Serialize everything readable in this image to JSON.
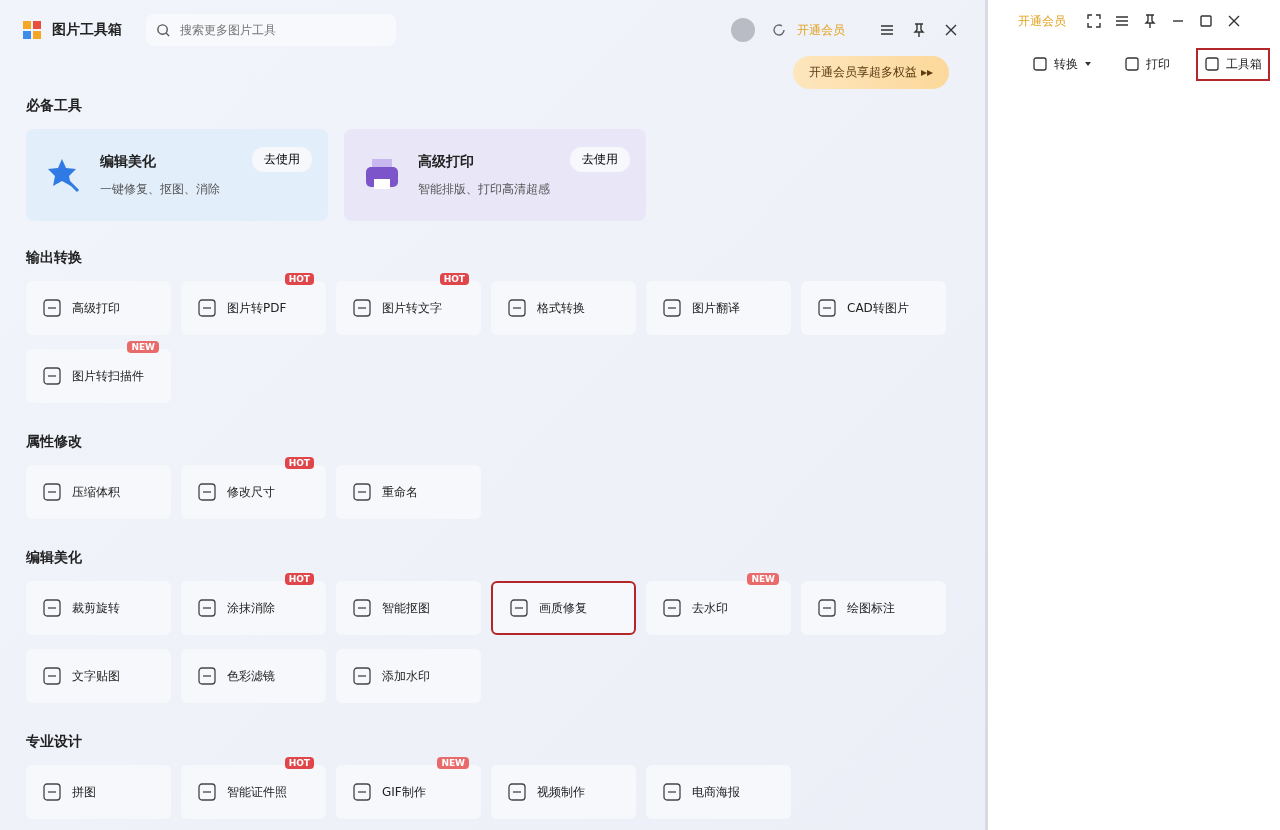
{
  "toolbox": {
    "title": "图片工具箱",
    "search": {
      "placeholder": "搜索更多图片工具"
    },
    "vip_link": "开通会员",
    "promo": "开通会员享超多权益 ▸▸",
    "essentials": {
      "heading": "必备工具",
      "cards": [
        {
          "kind": "edit",
          "title": "编辑美化",
          "subtitle": "一键修复、抠图、消除",
          "action": "去使用"
        },
        {
          "kind": "print",
          "title": "高级打印",
          "subtitle": "智能排版、打印高清超感",
          "action": "去使用"
        }
      ]
    },
    "sections": [
      {
        "heading": "输出转换",
        "tools": [
          {
            "label": "高级打印",
            "highlighted": false
          },
          {
            "label": "图片转PDF",
            "badge": "HOT",
            "highlighted": false
          },
          {
            "label": "图片转文字",
            "badge": "HOT",
            "highlighted": false
          },
          {
            "label": "格式转换",
            "highlighted": false
          },
          {
            "label": "图片翻译",
            "highlighted": false
          },
          {
            "label": "CAD转图片",
            "highlighted": false
          },
          {
            "label": "图片转扫描件",
            "badge": "NEW",
            "highlighted": false
          }
        ]
      },
      {
        "heading": "属性修改",
        "tools": [
          {
            "label": "压缩体积",
            "highlighted": false
          },
          {
            "label": "修改尺寸",
            "badge": "HOT",
            "highlighted": false
          },
          {
            "label": "重命名",
            "highlighted": false
          }
        ]
      },
      {
        "heading": "编辑美化",
        "tools": [
          {
            "label": "裁剪旋转",
            "highlighted": false
          },
          {
            "label": "涂抹消除",
            "badge": "HOT",
            "highlighted": false
          },
          {
            "label": "智能抠图",
            "highlighted": false
          },
          {
            "label": "画质修复",
            "highlighted": true
          },
          {
            "label": "去水印",
            "badge": "NEW",
            "highlighted": false
          },
          {
            "label": "绘图标注",
            "highlighted": false
          },
          {
            "label": "文字贴图",
            "highlighted": false
          },
          {
            "label": "色彩滤镜",
            "highlighted": false
          },
          {
            "label": "添加水印",
            "highlighted": false
          }
        ]
      },
      {
        "heading": "专业设计",
        "tools": [
          {
            "label": "拼图",
            "highlighted": false
          },
          {
            "label": "智能证件照",
            "badge": "HOT",
            "highlighted": false
          },
          {
            "label": "GIF制作",
            "badge": "NEW",
            "highlighted": false
          },
          {
            "label": "视频制作",
            "highlighted": false
          },
          {
            "label": "电商海报",
            "highlighted": false
          }
        ]
      }
    ]
  },
  "main_window": {
    "vip_link": "开通会员",
    "toolbar": [
      {
        "label": "转换",
        "dropdown": true,
        "highlighted": false
      },
      {
        "label": "打印",
        "dropdown": false,
        "highlighted": false
      },
      {
        "label": "工具箱",
        "dropdown": false,
        "highlighted": true
      }
    ]
  }
}
